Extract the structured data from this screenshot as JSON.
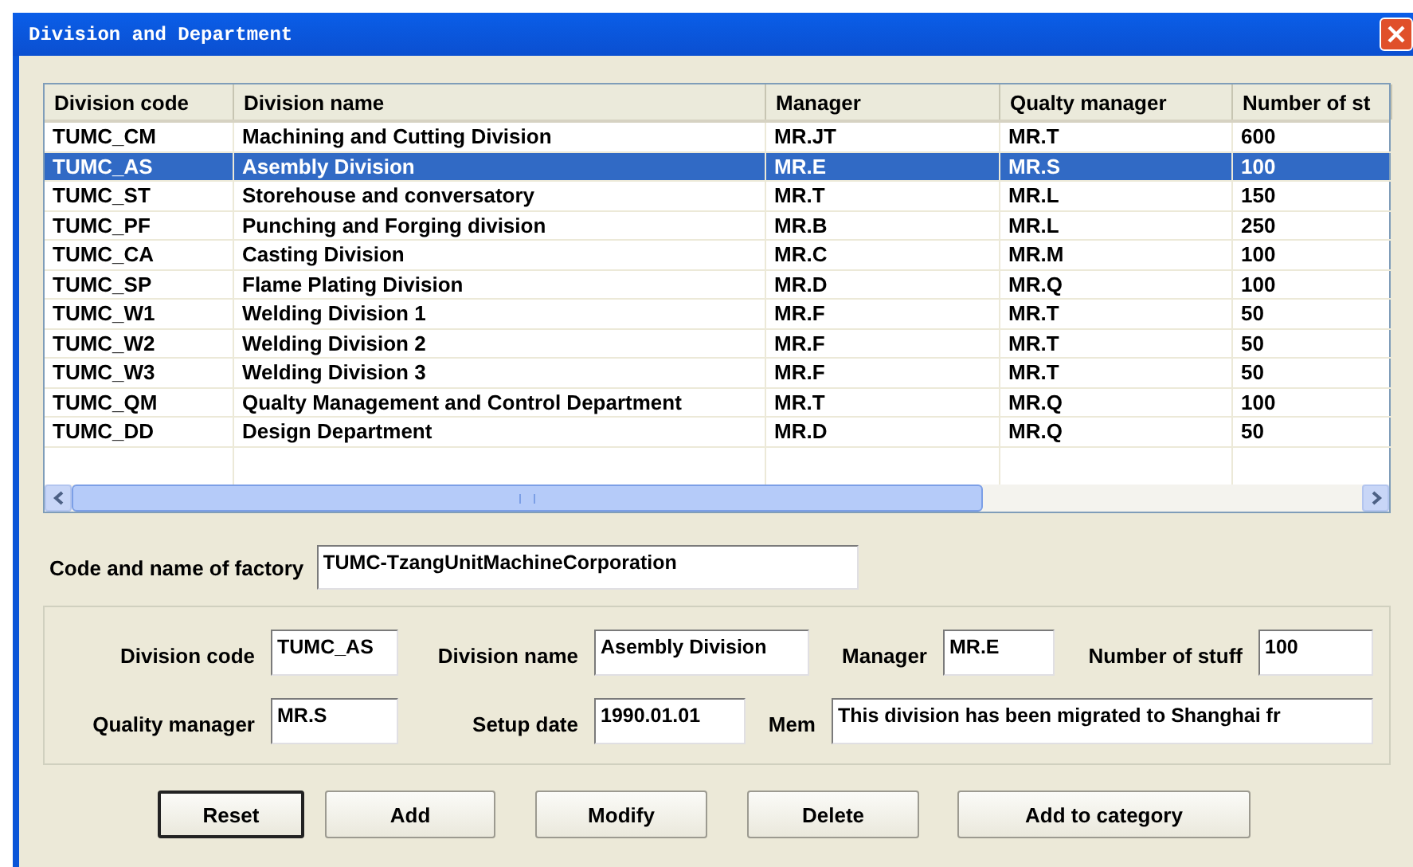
{
  "window": {
    "title": "Division and Department"
  },
  "table": {
    "columns": [
      "Division code",
      "Division name",
      "Manager",
      "Qualty manager",
      "Number of st"
    ],
    "rows": [
      {
        "cells": [
          "TUMC_CM",
          "Machining and Cutting Division",
          "MR.JT",
          "MR.T",
          "600"
        ],
        "selected": false
      },
      {
        "cells": [
          "TUMC_AS",
          "Asembly Division",
          "MR.E",
          "MR.S",
          "100"
        ],
        "selected": true
      },
      {
        "cells": [
          "TUMC_ST",
          "Storehouse and conversatory",
          "MR.T",
          "MR.L",
          "150"
        ],
        "selected": false
      },
      {
        "cells": [
          "TUMC_PF",
          "Punching and Forging division",
          "MR.B",
          "MR.L",
          "250"
        ],
        "selected": false
      },
      {
        "cells": [
          "TUMC_CA",
          "Casting Division",
          "MR.C",
          "MR.M",
          "100"
        ],
        "selected": false
      },
      {
        "cells": [
          "TUMC_SP",
          "Flame Plating Division",
          "MR.D",
          "MR.Q",
          "100"
        ],
        "selected": false
      },
      {
        "cells": [
          "TUMC_W1",
          "Welding Division 1",
          "MR.F",
          "MR.T",
          "50"
        ],
        "selected": false
      },
      {
        "cells": [
          "TUMC_W2",
          "Welding Division 2",
          "MR.F",
          "MR.T",
          "50"
        ],
        "selected": false
      },
      {
        "cells": [
          "TUMC_W3",
          "Welding Division 3",
          "MR.F",
          "MR.T",
          "50"
        ],
        "selected": false
      },
      {
        "cells": [
          "TUMC_QM",
          "Qualty Management and Control Department",
          "MR.T",
          "MR.Q",
          "100"
        ],
        "selected": false
      },
      {
        "cells": [
          "TUMC_DD",
          "Design Department",
          "MR.D",
          "MR.Q",
          "50"
        ],
        "selected": false
      }
    ]
  },
  "factory": {
    "label": "Code and name of factory",
    "value": "TUMC-TzangUnitMachineCorporation"
  },
  "form": {
    "rows": [
      [
        {
          "label": "Division code",
          "value": "TUMC_AS"
        },
        {
          "label": "Division name",
          "value": "Asembly Division"
        },
        {
          "label": "Manager",
          "value": "MR.E"
        },
        {
          "label": "Number of stuff",
          "value": "100"
        }
      ],
      [
        {
          "label": "Quality manager",
          "value": "MR.S"
        },
        {
          "label": "Setup date",
          "value": "1990.01.01"
        },
        {
          "label": "Mem",
          "value": "This division has been migrated to Shanghai fr"
        }
      ]
    ]
  },
  "buttons": [
    {
      "label": "Reset",
      "default": true
    },
    {
      "label": "Add",
      "default": false
    },
    {
      "label": "Modify",
      "default": false
    },
    {
      "label": "Delete",
      "default": false
    },
    {
      "label": "Add to category",
      "default": false
    }
  ]
}
